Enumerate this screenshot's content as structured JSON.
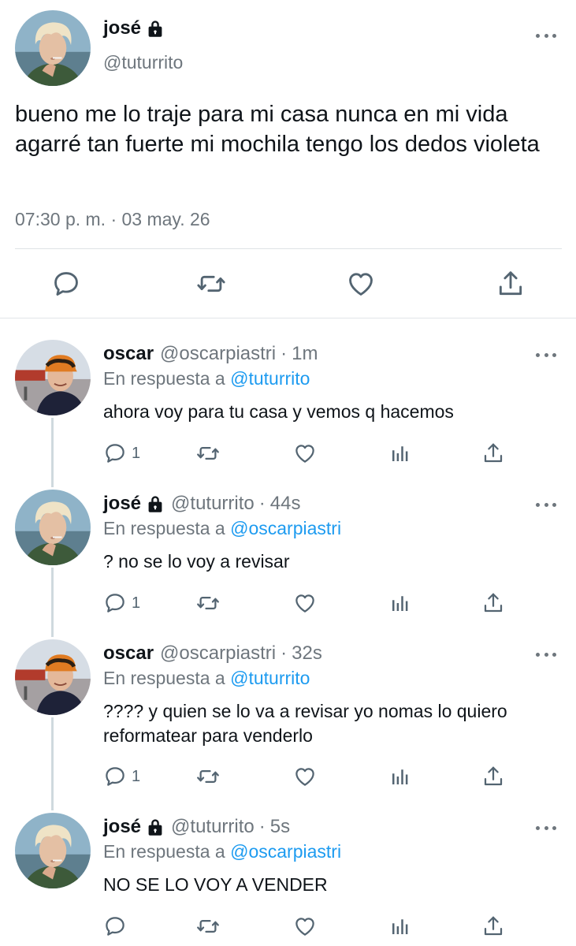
{
  "main": {
    "name": "josé",
    "handle": "@tuturrito",
    "text": "bueno me lo traje para mi casa nunca en mi vida agarré tan fuerte mi mochila tengo los dedos violeta",
    "timestamp": "07:30 p. m. · 03 may. 26"
  },
  "replies": [
    {
      "name": "oscar",
      "handle": "@oscarpiastri",
      "time": "1m",
      "replying_prefix": "En respuesta a",
      "replying_to": "@tuturrito",
      "text": "ahora voy para tu casa y vemos q hacemos",
      "reply_count": "1"
    },
    {
      "name": "josé",
      "handle": "@tuturrito",
      "time": "44s",
      "replying_prefix": "En respuesta a",
      "replying_to": "@oscarpiastri",
      "text": "? no se lo voy a revisar",
      "reply_count": "1"
    },
    {
      "name": "oscar",
      "handle": "@oscarpiastri",
      "time": "32s",
      "replying_prefix": "En respuesta a",
      "replying_to": "@tuturrito",
      "text": "???? y quien se lo va a revisar yo nomas lo quiero reformatear para venderlo",
      "reply_count": "1"
    },
    {
      "name": "josé",
      "handle": "@tuturrito",
      "time": "5s",
      "replying_prefix": "En respuesta a",
      "replying_to": "@oscarpiastri",
      "text": "NO SE LO VOY A VENDER",
      "reply_count": ""
    }
  ],
  "separator": "·",
  "colors": {
    "text": "#0f1419",
    "secondary": "#6e767d",
    "link": "#1d9bf0",
    "thread_line": "#cfd9de"
  }
}
